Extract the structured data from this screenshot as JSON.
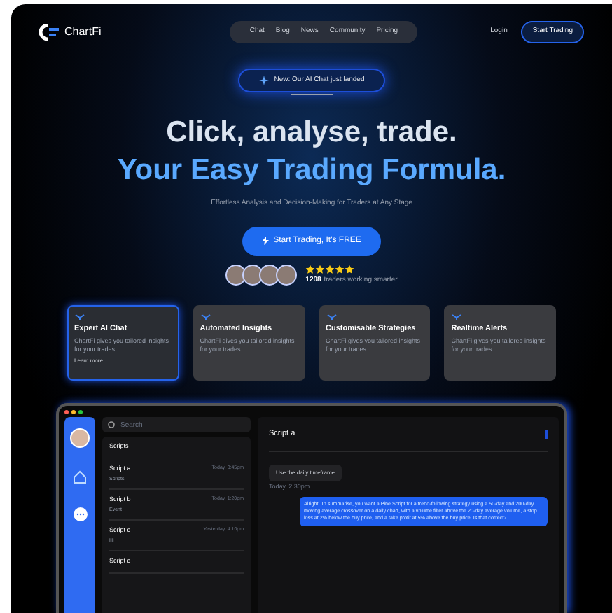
{
  "nav": {
    "logo": "ChartFi",
    "links": [
      "Chat",
      "Blog",
      "News",
      "Community",
      "Pricing"
    ],
    "login": "Login",
    "cta": "Start Trading"
  },
  "hero": {
    "badge": "New: Our AI Chat just landed",
    "title": "Click, analyse, trade.",
    "subtitle": "Your Easy Trading Formula.",
    "tagline": "Effortless Analysis and Decision-Making for Traders at Any Stage",
    "cta": "Start Trading, It's FREE",
    "stars": 5,
    "proof": "1208",
    "proof_text": "traders working smarter"
  },
  "features": [
    {
      "title": "Expert AI Chat",
      "text": "ChartFi gives you tailored insights for your trades.",
      "selected": true,
      "link": "Learn more"
    },
    {
      "title": "Automated Insights",
      "text": "ChartFi gives you tailored insights for your trades.",
      "selected": false
    },
    {
      "title": "Customisable Strategies",
      "text": "ChartFi gives you tailored insights for your trades.",
      "selected": false
    },
    {
      "title": "Realtime Alerts",
      "text": "ChartFi gives you tailored insights for your trades.",
      "selected": false
    }
  ],
  "app": {
    "dots": [
      {
        "color": "#ff5f57"
      },
      {
        "color": "#febc2e"
      },
      {
        "color": "#28c840"
      }
    ],
    "search": {
      "placeholder": "Search"
    },
    "list_title": "Scripts",
    "scripts": [
      {
        "name": "Script a",
        "sub": "Scripts",
        "time": "Today, 3:45pm",
        "selected": false
      },
      {
        "name": "Script b",
        "sub": "Event",
        "time": "Today, 1:20pm",
        "selected": false
      },
      {
        "name": "Script c",
        "sub": "Hi",
        "time": "Yesterday, 4:10pm",
        "selected": false
      },
      {
        "name": "Script d",
        "selected": false
      }
    ],
    "chat_title": "Script a",
    "user_message": "Use the daily timeframe",
    "user_time": "Today, 2:30pm",
    "reply": "Alright. To summarise, you want a Pine Script for a trend-following strategy using a 50-day and 200-day moving average crossover on a daily chart, with a volume filter above the 20-day average volume, a stop loss at 2% below the buy price, and a take profit at 5% above the buy price. Is that correct?"
  }
}
